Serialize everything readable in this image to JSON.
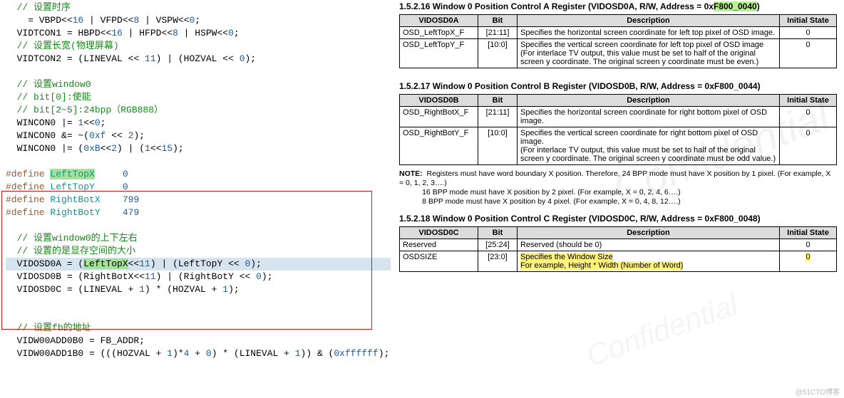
{
  "code": {
    "c1": "// 设置时序",
    "l2a": "    = VBPD",
    "l2b": "<<",
    "l2c": "16",
    "l2d": " | VFPD",
    "l2e": "<<",
    "l2f": "8",
    "l2g": " | VSPW",
    "l2h": "<<",
    "l2i": "0",
    "l2j": ";",
    "l3a": "  VIDTCON1 = HBPD",
    "l3b": "<<",
    "l3c": "16",
    "l3d": " | HFPD",
    "l3e": "<<",
    "l3f": "8",
    "l3g": " | HSPW",
    "l3h": "<<",
    "l3i": "0",
    "l3j": ";",
    "c4": "// 设置长宽(物理屏幕)",
    "l5a": "  VIDTCON2 = (LINEVAL ",
    "l5b": "<< ",
    "l5c": "11",
    "l5d": ") | (HOZVAL ",
    "l5e": "<< ",
    "l5f": "0",
    "l5g": ");",
    "c7": "// 设置window0",
    "c8": "// bit[0]:使能",
    "c9": "// bit[2~5]:24bpp（RGB888）",
    "l10a": "  WINCON0 |= ",
    "l10b": "1",
    "l10c": "<<",
    "l10d": "0",
    "l10e": ";",
    "l11a": "  WINCON0 &= ~(",
    "l11b": "0xf",
    "l11c": " << ",
    "l11d": "2",
    "l11e": ");",
    "l12a": "  WINCON0 |= (",
    "l12b": "0xB",
    "l12c": "<<",
    "l12d": "2",
    "l12e": ") | (",
    "l12f": "1",
    "l12g": "<<",
    "l12h": "15",
    "l12i": ");",
    "d1": "#define ",
    "d1n": "LeftTopX",
    "d1v": "0",
    "d2": "#define ",
    "d2n": "LeftTopY",
    "d2v": "0",
    "d3": "#define ",
    "d3n": "RightBotX",
    "d3v": "799",
    "d4": "#define ",
    "d4n": "RightBotY",
    "d4v": "479",
    "c14": "// 设置window0的上下左右",
    "c15": "// 设置的是显存空间的大小",
    "l16a": "  VIDOSD0A = (",
    "l16b": "LeftTopX",
    "l16c": "<<",
    "l16d": "11",
    "l16e": ") | (LeftTopY ",
    "l16f": "<< ",
    "l16g": "0",
    "l16h": ");",
    "l17a": "  VIDOSD0B = (RightBotX",
    "l17b": "<<",
    "l17c": "11",
    "l17d": ") | (RightBotY ",
    "l17e": "<< ",
    "l17f": "0",
    "l17g": ");",
    "l18a": "  VIDOSD0C = (LINEVAL + ",
    "l18b": "1",
    "l18c": ") * (HOZVAL + ",
    "l18d": "1",
    "l18e": ");",
    "c20": "// 设置fb的地址",
    "l21": "  VIDW00ADD0B0 = FB_ADDR;",
    "l22a": "  VIDW00ADD1B0 = (((HOZVAL + ",
    "l22b": "1",
    "l22c": ")*",
    "l22d": "4",
    "l22e": " + ",
    "l22f": "0",
    "l22g": ") * (LINEVAL + ",
    "l22h": "1",
    "l22i": ")) & (",
    "l22j": "0xffffff",
    "l22k": ");"
  },
  "sec1": {
    "title_a": "1.5.2.16  Window 0 Position Control A Register (VIDOSD0A, R/W, Address = 0x",
    "title_b": "F800_0040",
    "title_c": ")",
    "h1": "VIDOSD0A",
    "h2": "Bit",
    "h3": "Description",
    "h4": "Initial State",
    "r1c1": "OSD_LeftTopX_F",
    "r1c2": "[21:11]",
    "r1c3": "Specifies the horizontal screen coordinate for left top pixel of OSD image.",
    "r1c4": "0",
    "r2c1": "OSD_LeftTopY_F",
    "r2c2": "[10:0]",
    "r2c3": "Specifies the vertical screen coordinate for left top pixel of OSD image\n(For interlace TV output, this value must be set to half of the original screen y coordinate. The original screen y coordinate must be even.)",
    "r2c4": "0"
  },
  "sec2": {
    "title": "1.5.2.17  Window 0 Position Control B Register (VIDOSD0B, R/W, Address = 0xF800_0044)",
    "h1": "VIDOSD0B",
    "h2": "Bit",
    "h3": "Description",
    "h4": "Initial State",
    "r1c1": "OSD_RightBotX_F",
    "r1c2": "[21:11]",
    "r1c3": "Specifies the horizontal screen coordinate for right bottom pixel of OSD image.",
    "r1c4": "0",
    "r2c1": "OSD_RightBotY_F",
    "r2c2": "[10:0]",
    "r2c3": "Specifies the vertical screen coordinate for right bottom pixel of OSD image.\n(For interlace TV output, this value must be set to half of the original screen y coordinate. The original screen y coordinate must be odd value.)",
    "r2c4": "0"
  },
  "note": {
    "label": "NOTE:",
    "l1": "Registers must have word boundary X position. Therefore, 24 BPP mode must have X position by 1 pixel. (For example, X = 0, 1, 2, 3….)",
    "l2": "16 BPP mode must have X position by 2 pixel. (For example, X = 0, 2, 4, 6….)",
    "l3": "8 BPP mode must have X position by 4 pixel. (For example, X = 0, 4, 8, 12….)"
  },
  "sec3": {
    "title": "1.5.2.18  Window 0 Position Control C Register (VIDOSD0C, R/W, Address = 0xF800_0048)",
    "h1": "VIDOSD0C",
    "h2": "Bit",
    "h3": "Description",
    "h4": "Initial State",
    "r1c1": "Reserved",
    "r1c2": "[25:24]",
    "r1c3": "Reserved (should be 0)",
    "r1c4": "0",
    "r2c1": "OSDSIZE",
    "r2c2": "[23:0]",
    "r2c3a": "Specifies the Window Size",
    "r2c3b": "For example, Height * Width (Number of Word)",
    "r2c4": "0"
  },
  "footer": "@51CTO博客",
  "wm": "Confidential"
}
